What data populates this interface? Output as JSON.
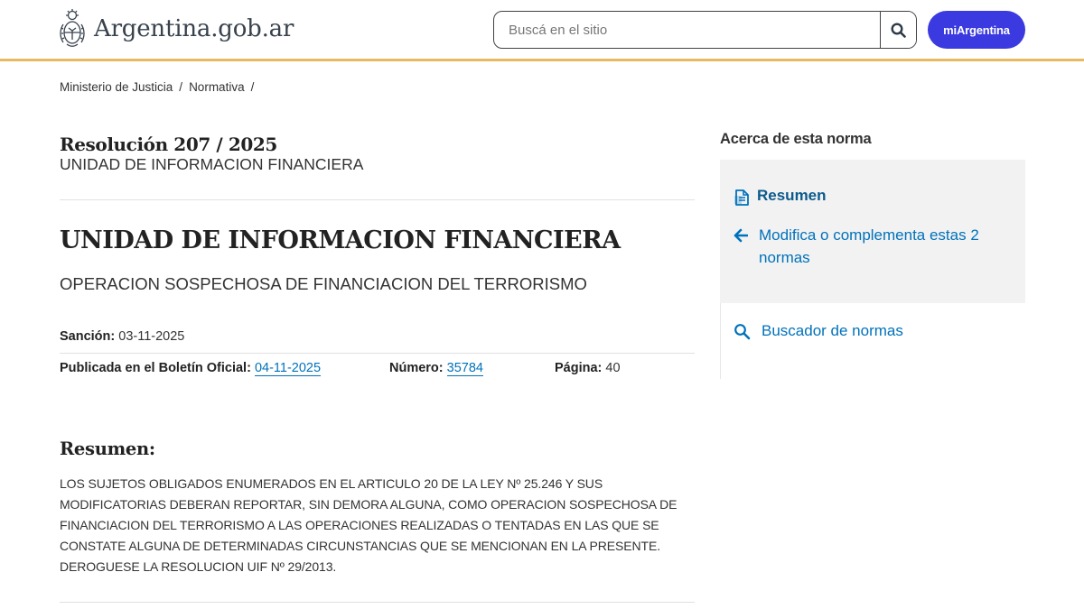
{
  "header": {
    "logo_text": "Argentina.gob.ar",
    "search_placeholder": "Buscá en el sitio",
    "mi_argentina_label": "miArgentina",
    "colors": {
      "accent_border": "#e7ba61",
      "button": "#3a3ae0"
    }
  },
  "breadcrumb": {
    "items": [
      "Ministerio de Justicia",
      "Normativa"
    ],
    "separator": "/"
  },
  "document": {
    "title": "Resolución 207 / 2025",
    "organism": "UNIDAD DE INFORMACION FINANCIERA",
    "heading": "UNIDAD DE INFORMACION FINANCIERA",
    "subheading": "OPERACION SOSPECHOSA DE FINANCIACION DEL TERRORISMO",
    "sancion_label": "Sanción:",
    "sancion_value": "03-11-2025",
    "publicada_label": "Publicada en el Boletín Oficial:",
    "publicada_value": "04-11-2025",
    "numero_label": "Número:",
    "numero_value": "35784",
    "pagina_label": "Página:",
    "pagina_value": "40",
    "resumen_heading": "Resumen:",
    "resumen_text": "LOS SUJETOS OBLIGADOS ENUMERADOS EN EL ARTICULO 20 DE LA LEY Nº 25.246 Y SUS MODIFICATORIAS DEBERAN REPORTAR, SIN DEMORA ALGUNA, COMO OPERACION SOSPECHOSA DE FINANCIACION DEL TERRORISMO A LAS OPERACIONES REALIZADAS O TENTADAS EN LAS QUE SE CONSTATE ALGUNA DE DETERMINADAS CIRCUNSTANCIAS QUE SE MENCIONAN EN LA PRESENTE. DEROGUESE LA RESOLUCION UIF Nº 29/2013."
  },
  "sidebar": {
    "title": "Acerca de esta norma",
    "resumen_link": "Resumen",
    "modifica_link": "Modifica o complementa estas 2 normas",
    "buscador_link": "Buscador de normas",
    "icons": [
      "document-icon",
      "arrow-left-icon",
      "search-icon"
    ]
  }
}
